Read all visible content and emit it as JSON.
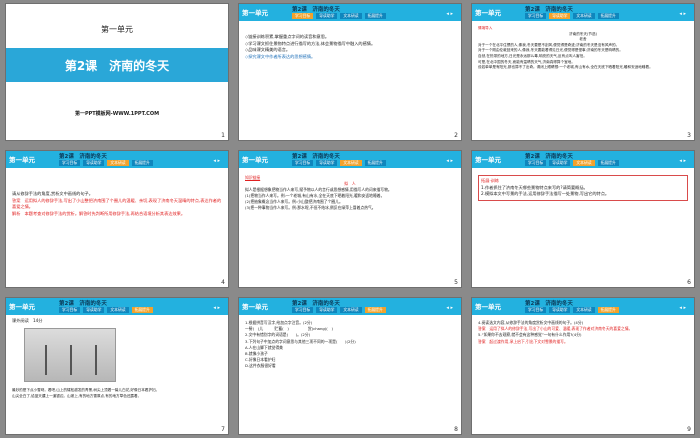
{
  "slides": [
    {
      "num": "1",
      "unit": "第一单元",
      "lesson": "第2课　济南的冬天",
      "site": "第一PPT模板网-WWW.1PPT.COM"
    },
    {
      "num": "2",
      "header": {
        "tag": "第一单元",
        "title": "第2课　济南的冬天",
        "tabs": [
          "学习目标",
          "导读助学",
          "文本研读",
          "拓展提升"
        ],
        "active_tab": 0,
        "ctl": "◂ ▸"
      },
      "lines": [
        "◇链接训练积累,掌握重点字词的读音和意思。",
        "◇学习课文抓住景物特点进行描写的方法,体会景物描写中融入的感情。",
        "◇品味课文精美的语言。",
        "◇探究课文中作者所表达的思想感情。"
      ]
    },
    {
      "num": "3",
      "header": {
        "tag": "第一单元",
        "title": "第2课　济南的冬天",
        "tabs": [
          "学习目标",
          "导读助学",
          "文本研读",
          "拓展提升"
        ],
        "active_tab": 1,
        "ctl": "◂ ▸"
      },
      "heading": "情境导入",
      "title2": "济南的冬天(节选)",
      "author": "老舍",
      "lines": [
        "对于一个在北平住惯的人,像我,冬天要是不刮风,便觉得是奇迹;济南的冬天是没有风声的。",
        "对于一个刚由伦敦回来的人,像我,冬天要能看得见日光,便觉得是怪事;济南的冬天是响晴的。",
        "自然,在热带的地方,日光是永远那么毒,响亮的天气,反有点叫人害怕。",
        "可是,在北中国的冬天,而能有温晴的天气,济南真得算个宝地。",
        "设若单单是有阳光,那也算不了出奇。请闭上眼睛想:一个老城,有山有水,全在天底下晒着阳光,暖和安适地睡着。"
      ]
    },
    {
      "num": "4",
      "header": {
        "tag": "第一单元",
        "title": "第2课　济南的冬天",
        "tabs": [
          "学习目标",
          "导读助学",
          "文本研读",
          "拓展提升"
        ],
        "active_tab": 2,
        "ctl": "◂ ▸"
      },
      "lines": [
        "请从修辞手法的角度,赏析文中画线的句子。",
        "答案　运用拟人的修辞手法,写出了小山整把济南围了个圈儿的温暖、亲切,表现了济南冬天温晴的特点,表达作者的喜爱之情。",
        "解析　本题考查对修辞手法的赏析。解答时先判断所用修辞手法,再结合语境分析其表达效果。"
      ]
    },
    {
      "num": "5",
      "header": {
        "tag": "第一单元",
        "title": "第2课　济南的冬天",
        "tabs": [
          "学习目标",
          "导读助学",
          "文本研读",
          "拓展提升"
        ],
        "active_tab": 2,
        "ctl": "◂ ▸"
      },
      "heading": "知识链接",
      "sub": "拟　人",
      "lines": [
        "拟人是根据想象把物当作人来写,赋予物以人的言行或思想感情,用描写人的词来描写物。",
        "(1)把物当作人来写。例:一个老城,有山有水,全在天底下晒着阳光,暖和安适地睡着。",
        "(2)把抽象概念当作人来写。例:小山整把济南围了个圈儿。",
        "(3)把一种事物当作人来写。例:那水呢,不但不结冰,倒反在绿萍上冒着点热气。"
      ]
    },
    {
      "num": "6",
      "header": {
        "tag": "第一单元",
        "title": "第2课　济南的冬天",
        "tabs": [
          "学习目标",
          "导读助学",
          "文本研读",
          "拓展提升"
        ],
        "active_tab": 2,
        "ctl": "◂ ▸"
      },
      "heading": "拓展·训练",
      "lines": [
        "1.作者抓住了济南冬天哪些景物特点来写的?请简要概括。",
        "2.模拟本文中写景的手法,运用修辞手法描写一处景物,写出它的特点。"
      ]
    },
    {
      "num": "7",
      "header": {
        "tag": "第一单元",
        "title": "第2课　济南的冬天",
        "tabs": [
          "学习目标",
          "导读助学",
          "文本研读",
          "拓展提升"
        ],
        "active_tab": 3,
        "ctl": "◂ ▸"
      },
      "reading": "课外阅读　14分",
      "lines": [
        "最妙的是下点小雪呀。看吧,山上的矮松越发的青黑,树尖上顶着一髻儿白花,好像日本看护妇。",
        "山尖全白了,给蓝天镶上一道银边。山坡上,有的地方雪厚点,有的地方草色还露着。"
      ]
    },
    {
      "num": "8",
      "header": {
        "tag": "第一单元",
        "title": "第2课　济南的冬天",
        "tabs": [
          "学习目标",
          "导读助学",
          "文本研读",
          "拓展提升"
        ],
        "active_tab": 3,
        "ctl": "◂ ▸"
      },
      "lines": [
        "1.根据拼音写汉字,给加点字注音。(2分)",
        "一髻(　)儿　　　贮蓄(　)　　　　　赏(chang)(　)",
        "2.文中有错别字的词语是(　　)。(2分)",
        "3.下列句子中加点的字词意思与其他三项不同的一项是(　　)(2分)",
        "A.人在山脚下就觉得美",
        "B.就像小孩子",
        "C.好像日本看护妇",
        "D.这件衣服很好看"
      ]
    },
    {
      "num": "9",
      "header": {
        "tag": "第一单元",
        "title": "第2课　济南的冬天",
        "tabs": [
          "学习目标",
          "导读助学",
          "文本研读",
          "拓展提升"
        ],
        "active_tab": 3,
        "ctl": "◂ ▸"
      },
      "lines": [
        "4.阅读选文内容,从修辞手法的角度赏析文中画线的句子。(4分)",
        "答案　运用了拟人的修辞手法,写出了小山的可爱、温暖,表现了作者对济南冬天的喜爱之情。",
        "5.“如果你不去观察,就不会有这种感觉”一句有什么作用?(4分)",
        "答案　起过渡作用,承上启下,引出下文对雪景的描写。"
      ]
    }
  ]
}
